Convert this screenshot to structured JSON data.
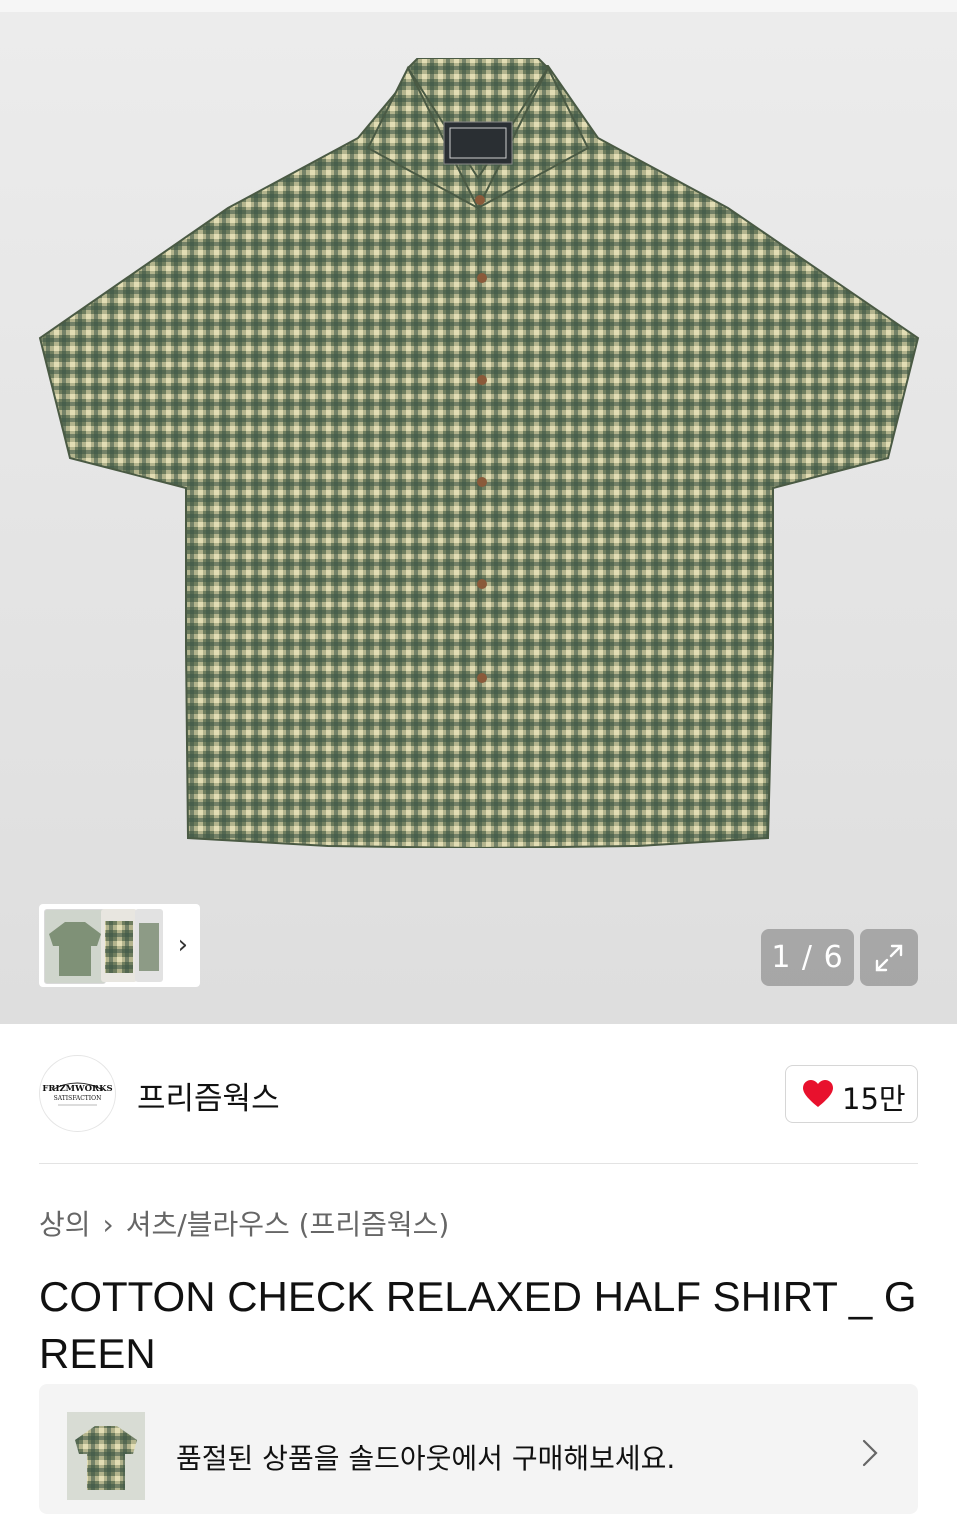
{
  "gallery": {
    "counter": "1 / 6",
    "expand_icon": "expand-arrows-icon",
    "thumbnail_more_icon": "chevron-right-icon"
  },
  "brand": {
    "name": "프리즘웍스",
    "logo_text": "FRIZMWORKS SATISFACTION",
    "like_count": "15만",
    "like_icon": "heart-icon"
  },
  "breadcrumb": {
    "level1": "상의",
    "separator_icon": "chevron-right-icon",
    "level2": "셔츠/블라우스 (프리즘웍스)"
  },
  "product": {
    "title": "COTTON CHECK RELAXED HALF SHIRT _ GREEN"
  },
  "soldout_banner": {
    "message": "품절된 상품을 솔드아웃에서 구매해보세요."
  },
  "colors": {
    "shirt_base": "#6b7a5c",
    "shirt_check_light": "#c8c79a",
    "shirt_check_dark": "#3e5848",
    "like_heart": "#e8112d"
  }
}
